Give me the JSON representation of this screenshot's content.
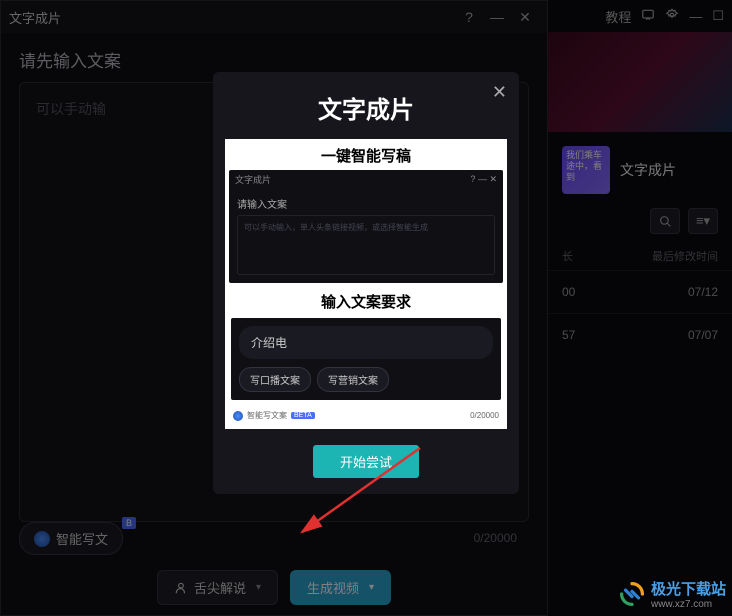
{
  "main": {
    "title": "文字成片",
    "prompt_title": "请先输入文案",
    "placeholder_partial": "可以手动输",
    "smart_chip": "智能写文",
    "smart_badge": "B",
    "counter": "0/20000",
    "narrator_btn": "舌尖解说",
    "generate_btn": "生成视频"
  },
  "right": {
    "tutorial": "教程",
    "card_thumb_text": "我们乘车途中，看到",
    "card_label": "文字成片",
    "col_duration": "长",
    "col_modified": "最后修改时间",
    "rows": [
      {
        "d": "00",
        "t": "07/12"
      },
      {
        "d": "57",
        "t": "07/07"
      }
    ]
  },
  "modal": {
    "title": "文字成片",
    "section1": "一键智能写稿",
    "section2": "输入文案要求",
    "mini_title": "文字成片",
    "mini_prompt": "请输入文案",
    "mini_placeholder": "可以手动输入，单人头条链接视频，或选择智能生成",
    "mini_input": "介绍电",
    "tag1": "写口播文案",
    "tag2": "写营销文案",
    "mini_smart": "智能写文案",
    "mini_badge": "BETA",
    "mini_counter": "0/20000",
    "cta": "开始尝试"
  },
  "watermark": {
    "name": "极光下载站",
    "url": "www.xz7.com"
  }
}
